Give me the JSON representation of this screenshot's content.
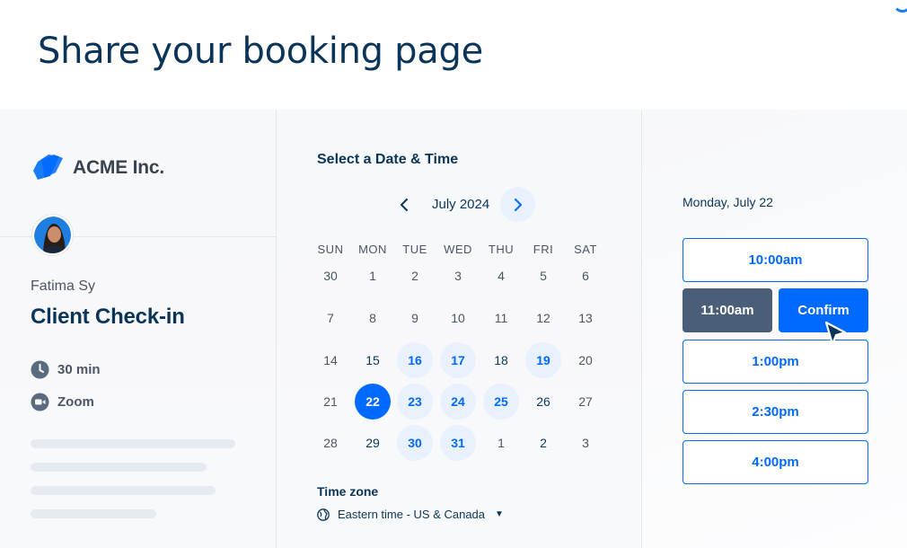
{
  "page": {
    "title": "Share your booking page"
  },
  "brand": {
    "name": "ACME Inc.",
    "accent": "#0069ff",
    "text": "#0b3558"
  },
  "host": {
    "name": "Fatima Sy"
  },
  "event": {
    "title": "Client Check-in",
    "duration": "30 min",
    "location": "Zoom"
  },
  "calendar": {
    "heading": "Select a Date & Time",
    "month": "July 2024",
    "weekdays": [
      "SUN",
      "MON",
      "TUE",
      "WED",
      "THU",
      "FRI",
      "SAT"
    ],
    "weeks": [
      [
        {
          "d": "30",
          "s": "muted"
        },
        {
          "d": "1",
          "s": "muted"
        },
        {
          "d": "2",
          "s": "muted"
        },
        {
          "d": "3",
          "s": "muted"
        },
        {
          "d": "4",
          "s": "muted"
        },
        {
          "d": "5",
          "s": "muted"
        },
        {
          "d": "6",
          "s": "muted"
        }
      ],
      [
        {
          "d": "7",
          "s": "muted"
        },
        {
          "d": "8",
          "s": "muted"
        },
        {
          "d": "9",
          "s": "muted"
        },
        {
          "d": "10",
          "s": "muted"
        },
        {
          "d": "11",
          "s": "muted"
        },
        {
          "d": "12",
          "s": "muted"
        },
        {
          "d": "13",
          "s": "muted"
        }
      ],
      [
        {
          "d": "14",
          "s": "muted"
        },
        {
          "d": "15",
          "s": "today"
        },
        {
          "d": "16",
          "s": "available"
        },
        {
          "d": "17",
          "s": "available"
        },
        {
          "d": "18",
          "s": "today"
        },
        {
          "d": "19",
          "s": "available"
        },
        {
          "d": "20",
          "s": "muted"
        }
      ],
      [
        {
          "d": "21",
          "s": "muted"
        },
        {
          "d": "22",
          "s": "selected"
        },
        {
          "d": "23",
          "s": "available"
        },
        {
          "d": "24",
          "s": "available"
        },
        {
          "d": "25",
          "s": "available"
        },
        {
          "d": "26",
          "s": "today"
        },
        {
          "d": "27",
          "s": "muted"
        }
      ],
      [
        {
          "d": "28",
          "s": "muted"
        },
        {
          "d": "29",
          "s": "today"
        },
        {
          "d": "30",
          "s": "available"
        },
        {
          "d": "31",
          "s": "available"
        },
        {
          "d": "1",
          "s": "muted"
        },
        {
          "d": "2",
          "s": "today"
        },
        {
          "d": "3",
          "s": "muted"
        }
      ]
    ]
  },
  "timezone": {
    "heading": "Time zone",
    "value": "Eastern time - US & Canada"
  },
  "times": {
    "date": "Monday, July 22",
    "slots": [
      "10:00am",
      "11:00am",
      "1:00pm",
      "2:30pm",
      "4:00pm"
    ],
    "selected": "11:00am",
    "confirm_label": "Confirm"
  }
}
